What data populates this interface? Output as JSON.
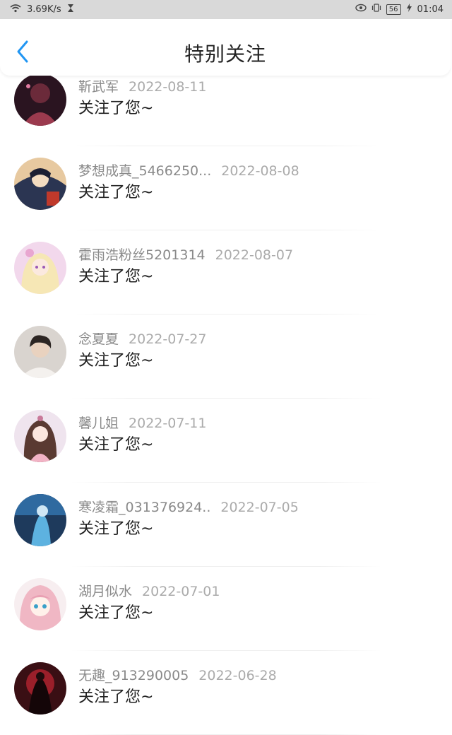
{
  "status_bar": {
    "net_speed": "3.69K/s",
    "battery": "56",
    "time": "01:04"
  },
  "header": {
    "title": "特别关注"
  },
  "items": [
    {
      "name": "靳武军",
      "date": "2022-08-11",
      "message": "关注了您~"
    },
    {
      "name": "梦想成真_5466250...",
      "date": "2022-08-08",
      "message": "关注了您~"
    },
    {
      "name": "霍雨浩粉丝5201314",
      "date": "2022-08-07",
      "message": "关注了您~"
    },
    {
      "name": "念夏夏",
      "date": "2022-07-27",
      "message": "关注了您~"
    },
    {
      "name": "馨儿姐",
      "date": "2022-07-11",
      "message": "关注了您~"
    },
    {
      "name": "寒凌霜_031376924..",
      "date": "2022-07-05",
      "message": "关注了您~"
    },
    {
      "name": "湖月似水",
      "date": "2022-07-01",
      "message": "关注了您~"
    },
    {
      "name": "无趣_913290005",
      "date": "2022-06-28",
      "message": "关注了您~"
    }
  ],
  "colors": {
    "accent": "#2196f3",
    "status_bar_bg": "#d9d9d9"
  }
}
